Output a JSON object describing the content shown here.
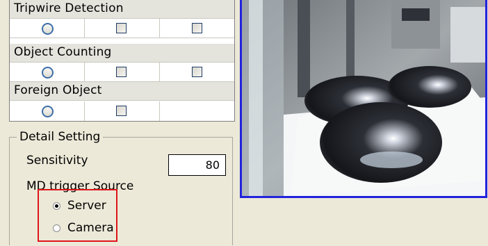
{
  "detection": {
    "sections": [
      {
        "name": "Tripwire Detection",
        "row": [
          "radio",
          "checkbox",
          "checkbox"
        ]
      },
      {
        "name": "Object Counting",
        "row": [
          "radio",
          "checkbox",
          "checkbox"
        ]
      },
      {
        "name": "Foreign Object",
        "row": [
          "radio",
          "checkbox",
          "empty"
        ]
      }
    ]
  },
  "detail": {
    "legend": "Detail Setting",
    "sensitivity_label": "Sensitivity",
    "sensitivity_value": "80",
    "md_trigger_label": "MD trigger Source",
    "options": [
      {
        "label": "Server",
        "checked": true
      },
      {
        "label": "Camera",
        "checked": false
      }
    ]
  },
  "colors": {
    "highlight": "#e0151a",
    "camera_border": "#2222dd"
  }
}
